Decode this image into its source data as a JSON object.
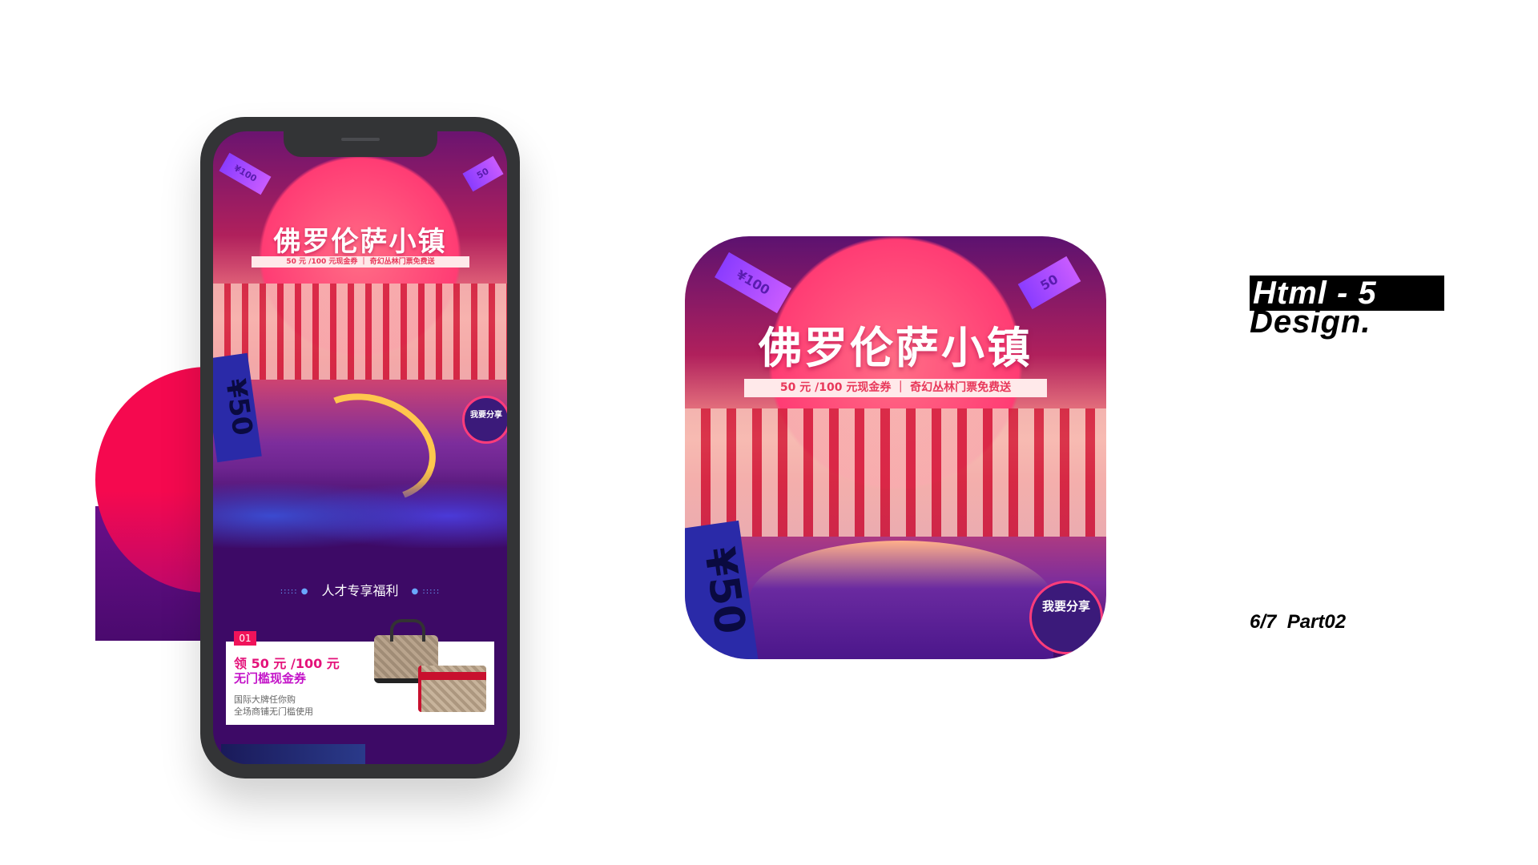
{
  "mobile_page": {
    "title": "佛罗伦萨小镇",
    "subtitle": "50 元 /100 元现金券 ｜ 奇幻丛林门票免费送",
    "bill_left": "¥100",
    "bill_right": "50",
    "ticket_text": "¥50",
    "share_button": "我要分享",
    "section_heading": "人才专享福利",
    "section_dots": "::::: ●",
    "section_dots_right": "● :::::",
    "card": {
      "badge": "01",
      "line1": "领 50 元 /100 元",
      "line2": "无门槛现金券",
      "line3": "国际大牌任你购",
      "line4": "全场商铺无门槛使用"
    }
  },
  "app_icon": {
    "title": "佛罗伦萨小镇",
    "subtitle": "50 元 /100 元现金券 ｜ 奇幻丛林门票免费送",
    "bill_left": "¥100",
    "bill_right": "50",
    "ticket_text": "¥50",
    "share_button": "我要分享"
  },
  "label": {
    "line1": "Html - 5",
    "line2": "Design.",
    "page": "6/7  Part02"
  },
  "colors": {
    "accent_pink": "#f5094f",
    "deep_purple": "#3d0a66"
  }
}
